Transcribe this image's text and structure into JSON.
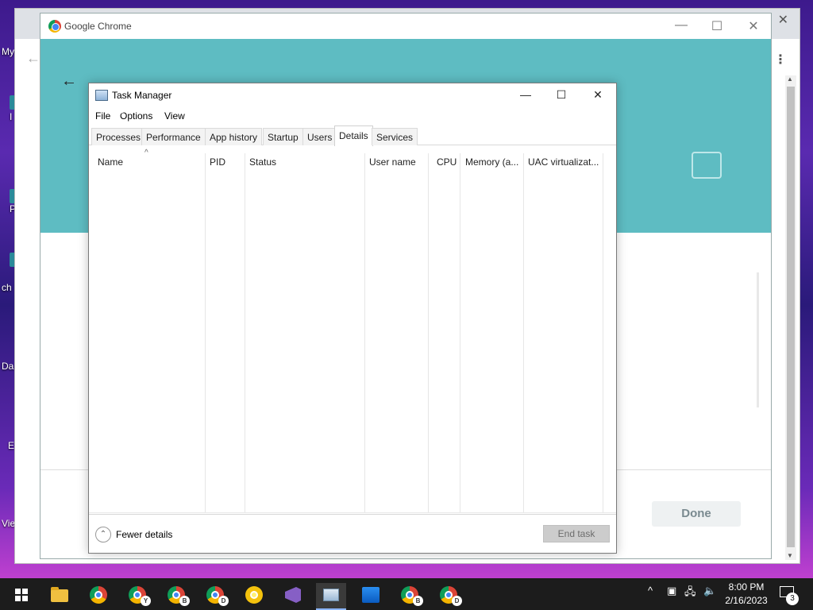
{
  "desktop": {
    "labels": [
      "My",
      "I",
      "P",
      "ch",
      "Da",
      "E",
      "Vie"
    ]
  },
  "background_window": {
    "close_glyph": "✕",
    "back_glyph": "←",
    "menu_glyph": "⋮"
  },
  "chrome": {
    "title": "Google Chrome",
    "minimize_glyph": "—",
    "maximize_glyph": "☐",
    "close_glyph": "✕",
    "back_glyph": "←",
    "done_label": "Done",
    "accent_color": "#5ebcc2"
  },
  "task_manager": {
    "title": "Task Manager",
    "minimize_glyph": "—",
    "maximize_glyph": "☐",
    "close_glyph": "✕",
    "menu": [
      "File",
      "Options",
      "View"
    ],
    "tabs": [
      "Processes",
      "Performance",
      "App history",
      "Startup",
      "Users",
      "Details",
      "Services"
    ],
    "active_tab": "Details",
    "columns": [
      "Name",
      "PID",
      "Status",
      "User name",
      "CPU",
      "Memory (a...",
      "UAC virtualizat..."
    ],
    "sort_glyph": "^",
    "fewer_details_label": "Fewer details",
    "fewer_details_glyph": "⌃",
    "end_task_label": "End task"
  },
  "taskbar": {
    "items": [
      "start-button",
      "file-explorer",
      "chrome",
      "chrome-profile-y",
      "chrome-profile-b",
      "chrome-profile-d",
      "chrome-canary",
      "visual-studio",
      "task-manager",
      "photos",
      "chrome-profile-b-2",
      "chrome-profile-d-2"
    ],
    "badges": {
      "chrome-profile-y": "Y",
      "chrome-profile-b": "B",
      "chrome-profile-d": "D",
      "chrome-profile-b-2": "B",
      "chrome-profile-d-2": "D"
    },
    "active_item": "task-manager",
    "time": "8:00 PM",
    "date": "2/16/2023",
    "notification_count": "3",
    "tray_chevron": "^"
  }
}
